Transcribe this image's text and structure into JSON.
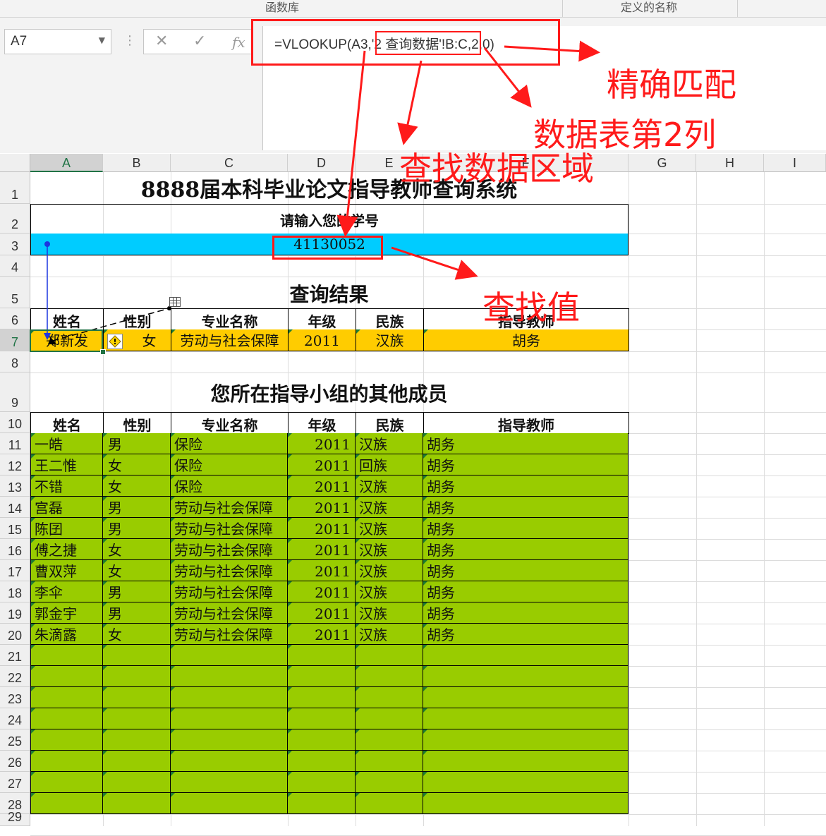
{
  "ribbon": {
    "groups": [
      "函数库",
      "定义的名称"
    ]
  },
  "formula_bar": {
    "name_box": "A7",
    "formula": "=VLOOKUP(A3,'2 查询数据'!B:C,2,0)",
    "icons": [
      "cancel-icon",
      "enter-icon",
      "function-icon"
    ]
  },
  "columns": [
    "A",
    "B",
    "C",
    "D",
    "E",
    "F",
    "G",
    "H",
    "I"
  ],
  "rows": [
    "1",
    "2",
    "3",
    "4",
    "5",
    "6",
    "7",
    "8",
    "9",
    "10",
    "11",
    "12",
    "13",
    "14",
    "15",
    "16",
    "17",
    "18",
    "19",
    "20",
    "21",
    "22",
    "23",
    "24",
    "25",
    "26",
    "27",
    "28",
    "29"
  ],
  "sheet": {
    "title": "8888届本科毕业论文指导教师查询系统",
    "prompt": "请输入您的学号",
    "student_id": "41130052",
    "result_title": "查询结果",
    "headers": [
      "姓名",
      "性别",
      "专业名称",
      "年级",
      "民族",
      "指导教师"
    ],
    "result": [
      "郑新发",
      "女",
      "劳动与社会保障",
      "2011",
      "汉族",
      "胡务"
    ],
    "group_title": "您所在指导小组的其他成员",
    "members": [
      [
        "一皓",
        "男",
        "保险",
        "2011",
        "汉族",
        "胡务"
      ],
      [
        "王二惟",
        "女",
        "保险",
        "2011",
        "回族",
        "胡务"
      ],
      [
        "不错",
        "女",
        "保险",
        "2011",
        "汉族",
        "胡务"
      ],
      [
        "宫磊",
        "男",
        "劳动与社会保障",
        "2011",
        "汉族",
        "胡务"
      ],
      [
        "陈囝",
        "男",
        "劳动与社会保障",
        "2011",
        "汉族",
        "胡务"
      ],
      [
        "傅之捷",
        "女",
        "劳动与社会保障",
        "2011",
        "汉族",
        "胡务"
      ],
      [
        "曹双萍",
        "女",
        "劳动与社会保障",
        "2011",
        "汉族",
        "胡务"
      ],
      [
        "李伞",
        "男",
        "劳动与社会保障",
        "2011",
        "汉族",
        "胡务"
      ],
      [
        "郭金宇",
        "男",
        "劳动与社会保障",
        "2011",
        "汉族",
        "胡务"
      ],
      [
        "朱滴露",
        "女",
        "劳动与社会保障",
        "2011",
        "汉族",
        "胡务"
      ]
    ]
  },
  "annotations": {
    "exact_match": "精确匹配",
    "column_2": "数据表第2列",
    "lookup_range": "查找数据区域",
    "lookup_value": "查找值"
  },
  "colors": {
    "header_blue": "#00ccff",
    "result_orange": "#ffcc00",
    "member_green": "#99cc00",
    "annotation_red": "#ff1a1a",
    "excel_green": "#217346"
  }
}
